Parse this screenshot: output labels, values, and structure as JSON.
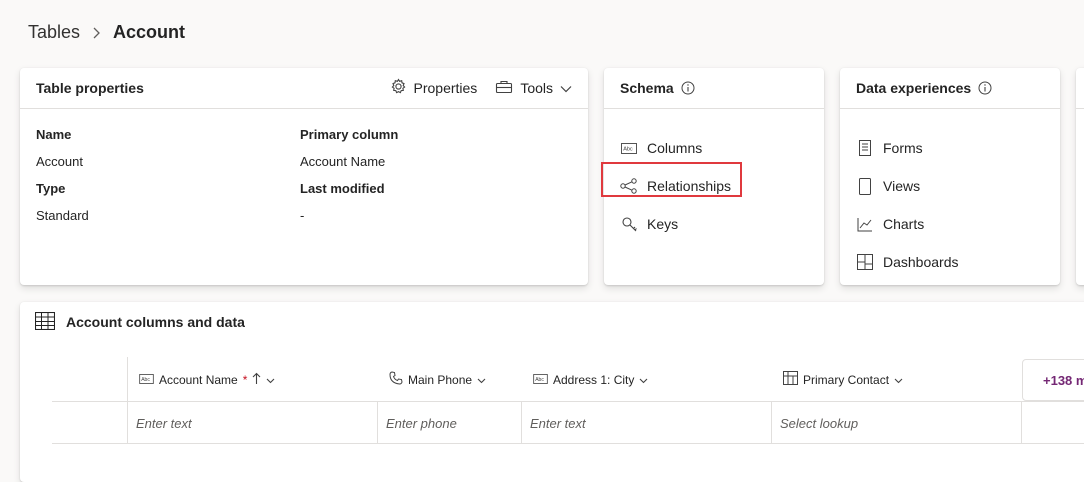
{
  "breadcrumb": {
    "parent": "Tables",
    "current": "Account"
  },
  "table_properties": {
    "title": "Table properties",
    "properties_button": "Properties",
    "tools_button": "Tools",
    "name_label": "Name",
    "name_value": "Account",
    "type_label": "Type",
    "type_value": "Standard",
    "primary_column_label": "Primary column",
    "primary_column_value": "Account Name",
    "last_modified_label": "Last modified",
    "last_modified_value": "-"
  },
  "schema": {
    "title": "Schema",
    "items": [
      "Columns",
      "Relationships",
      "Keys"
    ]
  },
  "data_experiences": {
    "title": "Data experiences",
    "items": [
      "Forms",
      "Views",
      "Charts",
      "Dashboards"
    ]
  },
  "columns_panel": {
    "title": "Account columns and data",
    "columns": [
      {
        "label": "Account Name",
        "required": "*",
        "placeholder": "Enter text",
        "icon": "text-field-icon"
      },
      {
        "label": "Main Phone",
        "placeholder": "Enter phone",
        "icon": "phone-icon"
      },
      {
        "label": "Address 1: City",
        "placeholder": "Enter text",
        "icon": "text-field-icon"
      },
      {
        "label": "Primary Contact",
        "placeholder": "Select lookup",
        "icon": "lookup-icon"
      }
    ],
    "more_columns": "+138 m"
  },
  "colors": {
    "accent": "#742774",
    "highlight": "#e0393e",
    "required": "#c50f1f"
  }
}
